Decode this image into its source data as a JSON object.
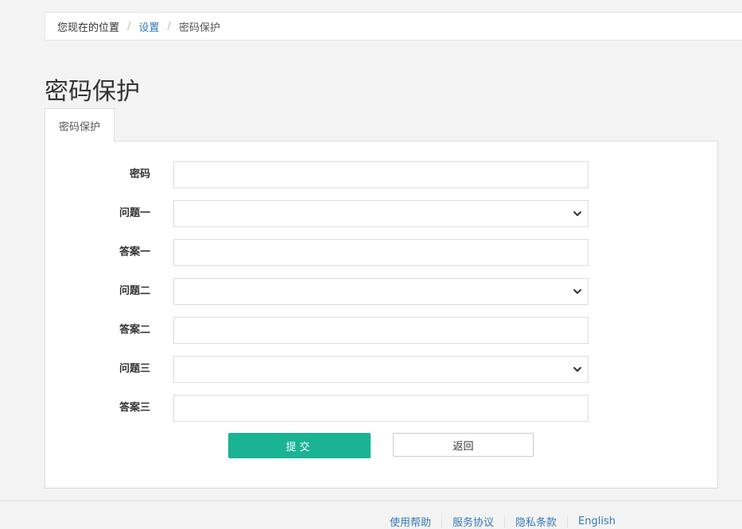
{
  "breadcrumb": {
    "location_label": "您现在的位置",
    "separator": "/",
    "link": "设置",
    "current": "密码保护"
  },
  "page": {
    "title": "密码保护",
    "tab": "密码保护"
  },
  "form": {
    "password_label": "密码",
    "password_value": "",
    "question1_label": "问题一",
    "question1_value": "",
    "answer1_label": "答案一",
    "answer1_value": "",
    "question2_label": "问题二",
    "question2_value": "",
    "answer2_label": "答案二",
    "answer2_value": "",
    "question3_label": "问题三",
    "question3_value": "",
    "answer3_label": "答案三",
    "answer3_value": "",
    "submit_label": "提交",
    "back_label": "返回"
  },
  "footer": {
    "links": [
      "使用帮助",
      "服务协议",
      "隐私条款",
      "English"
    ]
  },
  "colors": {
    "accent": "#1ab394",
    "link": "#337ab7",
    "background": "#f3f3f3"
  },
  "icons": {
    "select_arrow": "chevron-down-icon"
  }
}
